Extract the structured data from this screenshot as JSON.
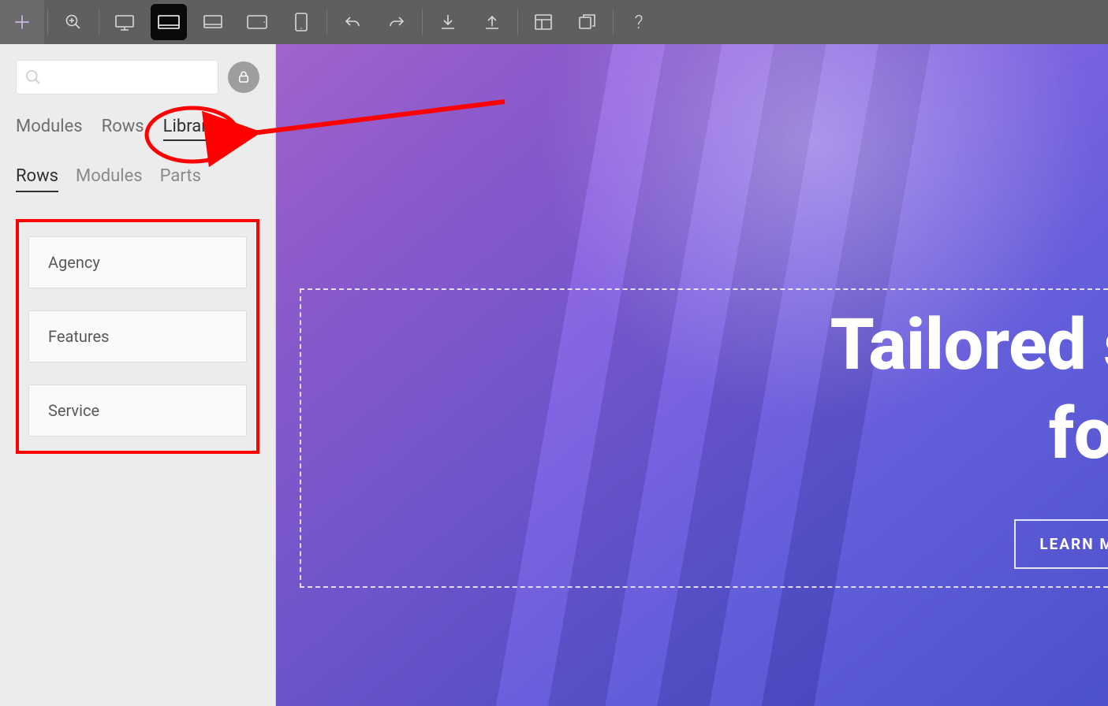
{
  "toolbar": {
    "help": "?"
  },
  "sidebar": {
    "search_placeholder": "",
    "primary_tabs": [
      {
        "label": "Modules"
      },
      {
        "label": "Rows"
      },
      {
        "label": "Library"
      }
    ],
    "secondary_tabs": [
      {
        "label": "Rows"
      },
      {
        "label": "Modules"
      },
      {
        "label": "Parts"
      }
    ],
    "items": [
      {
        "label": "Agency"
      },
      {
        "label": "Features"
      },
      {
        "label": "Service"
      }
    ]
  },
  "canvas": {
    "hero_line1": "Tailored s",
    "hero_line2": "for",
    "cta_label": "LEARN M"
  }
}
